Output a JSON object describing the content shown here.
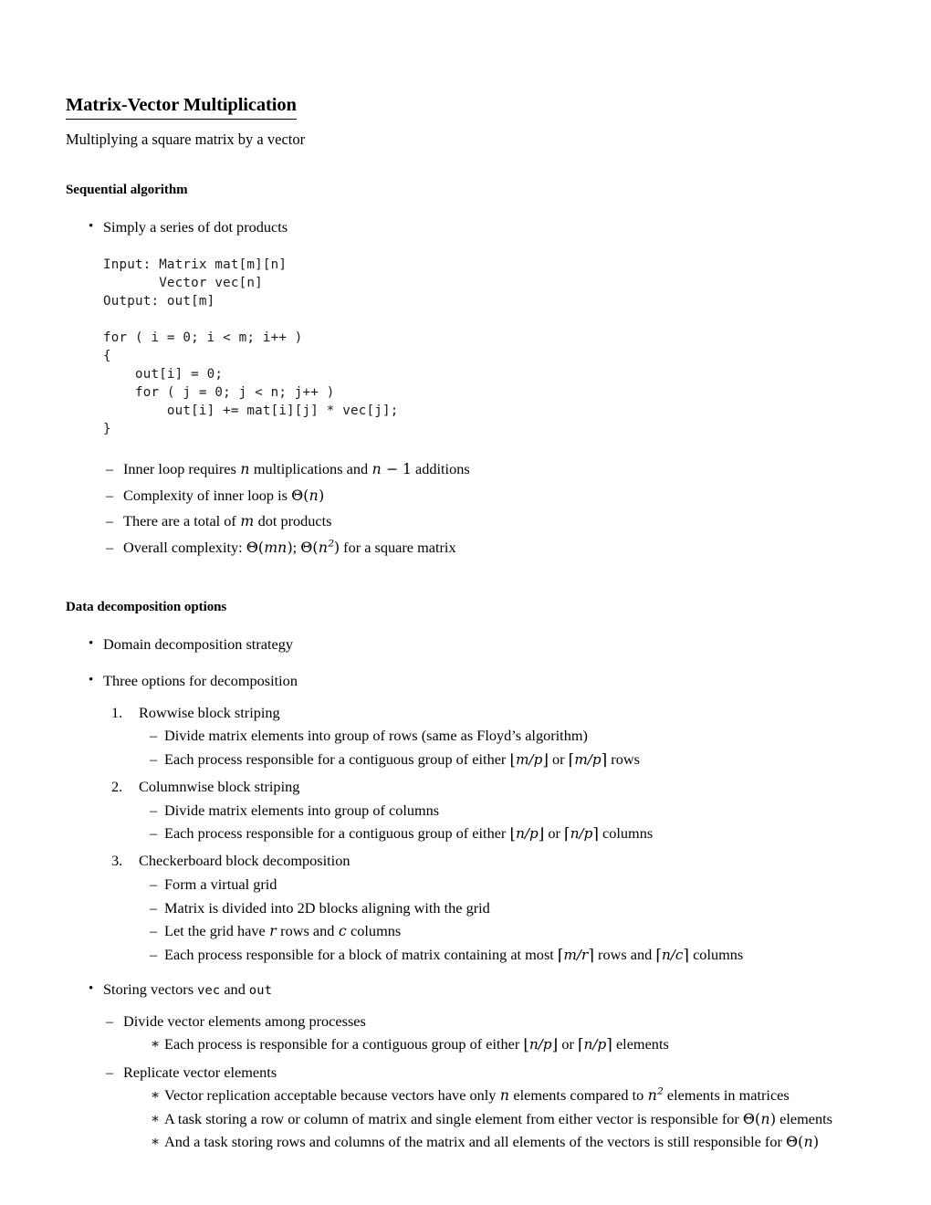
{
  "document": {
    "title": "Matrix-Vector Multiplication",
    "subtitle": "Multiplying a square matrix by a vector"
  },
  "sections": [
    {
      "heading": "Sequential algorithm",
      "bullet1": "Simply a series of dot products",
      "code": "Input: Matrix mat[m][n]\n       Vector vec[n]\nOutput: out[m]\n\nfor ( i = 0; i < m; i++ )\n{\n    out[i] = 0;\n    for ( j = 0; j < n; j++ )\n        out[i] += mat[i][j] * vec[j];\n}",
      "notes": [
        {
          "pre": "Inner loop requires ",
          "m1": "n",
          "mid": " multiplications and ",
          "m2": "n − 1",
          "post": " additions"
        },
        {
          "pre": "Complexity of inner loop is ",
          "math": "Θ(n)",
          "post": ""
        },
        {
          "pre": "There are a total of ",
          "m1": "m",
          "post": " dot products"
        },
        {
          "pre": "Overall complexity: ",
          "m1": "Θ(mn)",
          "mid": "; ",
          "m2": "Θ(n²)",
          "post": " for a square matrix"
        }
      ]
    },
    {
      "heading": "Data decomposition options",
      "bullets": [
        "Domain decomposition strategy",
        "Three options for decomposition"
      ],
      "options": [
        {
          "number": "1.",
          "label": "Rowwise block striping",
          "subs": [
            "Divide matrix elements into group of rows (same as Floyd’s algorithm)",
            "Each process responsible for a contiguous group of either ⌊m/p⌋ or ⌈m/p⌉ rows"
          ]
        },
        {
          "number": "2.",
          "label": "Columnwise block striping",
          "subs": [
            "Divide matrix elements into group of columns",
            "Each process responsible for a contiguous group of either ⌊n/p⌋ or ⌈n/p⌉ columns"
          ]
        },
        {
          "number": "3.",
          "label": "Checkerboard block decomposition",
          "subs": [
            "Form a virtual grid",
            "Matrix is divided into 2D blocks aligning with the grid",
            "Let the grid have r rows and c columns",
            "Each process responsible for a block of matrix containing at most ⌈m/r⌉ rows and ⌈n/c⌉ columns"
          ]
        }
      ],
      "storing": {
        "lead_pre": "Storing vectors ",
        "code1": "vec",
        "lead_mid": " and ",
        "code2": "out",
        "items": [
          {
            "label": "Divide vector elements among processes",
            "stars": [
              "Each process is responsible for a contiguous group of either ⌊n/p⌋ or ⌈n/p⌉ elements"
            ]
          },
          {
            "label": "Replicate vector elements",
            "stars": [
              "Vector replication acceptable because vectors have only n elements compared to n² elements in matrices",
              "A task storing a row or column of matrix and single element from either vector is responsible for Θ(n) elements",
              "And a task storing rows and columns of the matrix and all elements of the vectors is still responsible for Θ(n)"
            ]
          }
        ]
      }
    }
  ],
  "markers": {
    "bullet": "•",
    "dash": "–",
    "star": "∗"
  }
}
